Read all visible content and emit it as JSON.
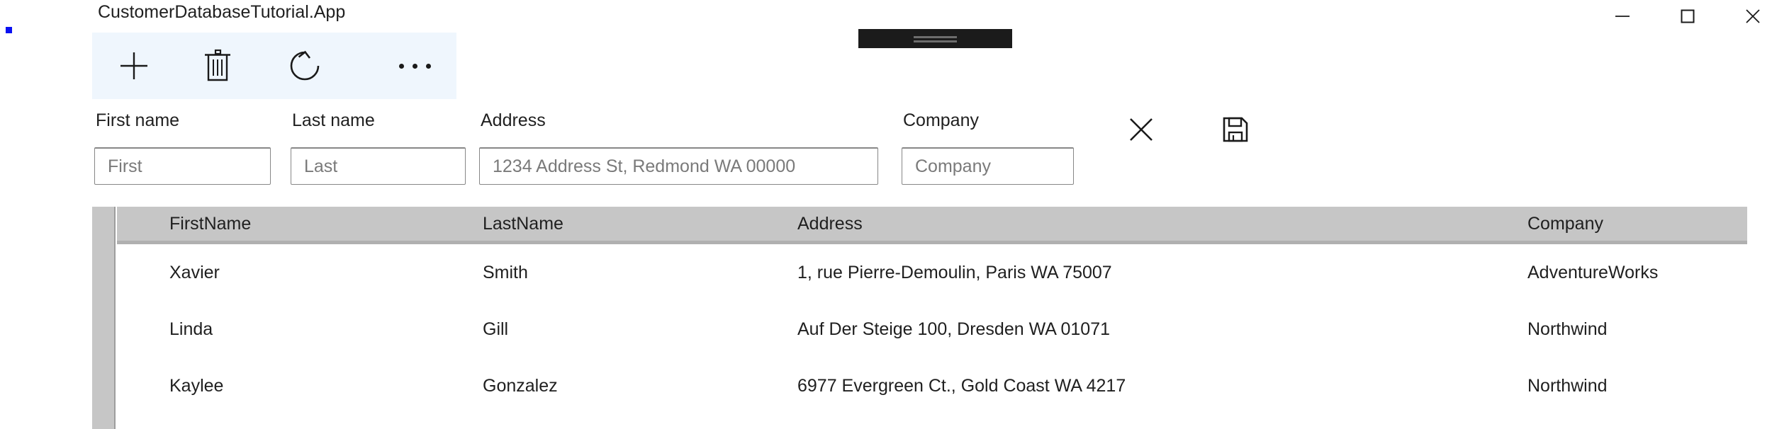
{
  "window": {
    "title": "CustomerDatabaseTutorial.App",
    "controls": [
      {
        "name": "minimize",
        "glyph": "minimize-icon"
      },
      {
        "name": "maximize",
        "glyph": "maximize-icon"
      },
      {
        "name": "close",
        "glyph": "close-icon"
      }
    ]
  },
  "overlay": {
    "name": "drag-grip-widget",
    "color": "#1b1b1b",
    "line_color": "#6d6d6d"
  },
  "marker": {
    "name": "blue-marker-dot",
    "color": "#0a11f2"
  },
  "commandbar": {
    "background": "#eff6fd",
    "buttons": [
      {
        "icon": "add-icon",
        "label": "Add"
      },
      {
        "icon": "delete-icon",
        "label": "Delete"
      },
      {
        "icon": "refresh-icon",
        "label": "Refresh"
      },
      {
        "icon": "more-icon",
        "label": "More"
      }
    ]
  },
  "form": {
    "fields": [
      {
        "label": "First name",
        "value": "",
        "placeholder": "First"
      },
      {
        "label": "Last name",
        "value": "",
        "placeholder": "Last"
      },
      {
        "label": "Address",
        "value": "",
        "placeholder": "1234 Address St, Redmond WA 00000"
      },
      {
        "label": "Company",
        "value": "",
        "placeholder": "Company"
      }
    ],
    "actions": [
      {
        "icon": "cancel-icon",
        "label": "Cancel"
      },
      {
        "icon": "save-icon",
        "label": "Save"
      }
    ]
  },
  "grid": {
    "header_background": "#c6c6c6",
    "columns": [
      "FirstName",
      "LastName",
      "Address",
      "Company"
    ],
    "rows": [
      {
        "FirstName": "Xavier",
        "LastName": "Smith",
        "Address": "1, rue Pierre-Demoulin, Paris WA 75007",
        "Company": "AdventureWorks"
      },
      {
        "FirstName": "Linda",
        "LastName": "Gill",
        "Address": "Auf Der Steige 100, Dresden WA 01071",
        "Company": "Northwind"
      },
      {
        "FirstName": "Kaylee",
        "LastName": "Gonzalez",
        "Address": "6977 Evergreen Ct., Gold Coast WA 4217",
        "Company": "Northwind"
      }
    ]
  }
}
